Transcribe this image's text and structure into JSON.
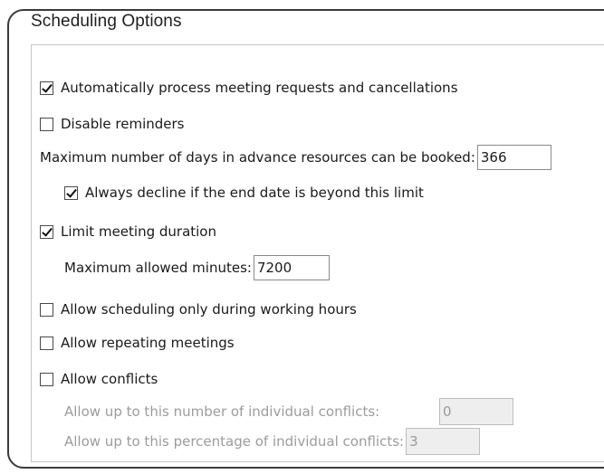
{
  "panel": {
    "title": "Scheduling Options"
  },
  "options": {
    "auto_process": {
      "label": "Automatically process meeting requests and cancellations",
      "checked": true
    },
    "disable_reminders": {
      "label": "Disable reminders",
      "checked": false
    },
    "max_days": {
      "label": "Maximum number of days in advance resources can be booked:",
      "value": "366"
    },
    "always_decline": {
      "label": "Always decline if the end date is beyond this limit",
      "checked": true
    },
    "limit_duration": {
      "label": "Limit meeting duration",
      "checked": true
    },
    "max_minutes": {
      "label": "Maximum allowed minutes:",
      "value": "7200"
    },
    "working_hours": {
      "label": "Allow scheduling only during working hours",
      "checked": false
    },
    "repeating": {
      "label": "Allow repeating meetings",
      "checked": false
    },
    "conflicts": {
      "label": "Allow conflicts",
      "checked": false
    },
    "conflict_count": {
      "label": "Allow up to this number of individual conflicts:",
      "value": "0"
    },
    "conflict_percent": {
      "label": "Allow up to this percentage of individual conflicts:",
      "value": "3"
    }
  }
}
